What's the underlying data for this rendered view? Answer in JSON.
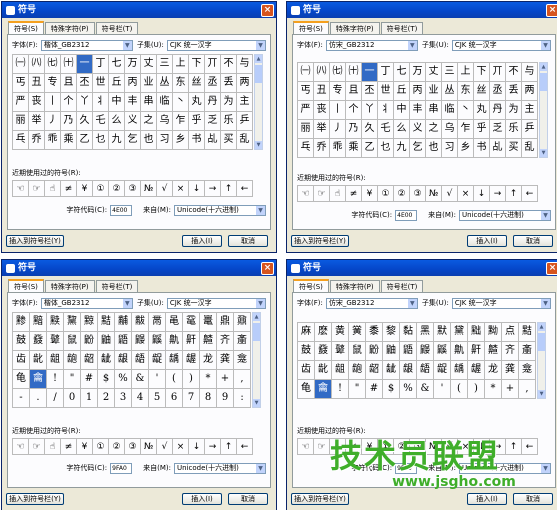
{
  "dialogs": [
    {
      "title": "符号",
      "tabs": [
        "符号(S)",
        "特殊字符(P)",
        "符号栏(T)"
      ],
      "font_label": "字体(F):",
      "font_value": "楷体_GB2312",
      "subset_label": "子集(U):",
      "subset_value": "CJK 统一汉字",
      "symbols": [
        [
          "㈠",
          "㈧",
          "㈦",
          "㈩",
          "一",
          "丁",
          "七",
          "万",
          "丈",
          "三",
          "上",
          "下",
          "丌",
          "不",
          "与"
        ],
        [
          "丐",
          "丑",
          "专",
          "且",
          "丕",
          "世",
          "丘",
          "丙",
          "业",
          "丛",
          "东",
          "丝",
          "丞",
          "丢",
          "两"
        ],
        [
          "严",
          "丧",
          "丨",
          "个",
          "丫",
          "丬",
          "中",
          "丰",
          "串",
          "临",
          "丶",
          "丸",
          "丹",
          "为",
          "主"
        ],
        [
          "丽",
          "举",
          "丿",
          "乃",
          "久",
          "乇",
          "么",
          "义",
          "之",
          "乌",
          "乍",
          "乎",
          "乏",
          "乐",
          "乒"
        ],
        [
          "乓",
          "乔",
          "乖",
          "乘",
          "乙",
          "乜",
          "九",
          "乞",
          "也",
          "习",
          "乡",
          "书",
          "乩",
          "买",
          "乱"
        ]
      ],
      "selected": [
        0,
        4
      ],
      "recent_label": "近期使用过的符号(R):",
      "recent": [
        "☜",
        "☞",
        "☝",
        "≠",
        "¥",
        "①",
        "②",
        "③",
        "№",
        "√",
        "×",
        "↓",
        "→",
        "↑",
        "←"
      ],
      "code_label": "字符代码(C):",
      "code_value": "4E00",
      "from_label": "来自(M):",
      "from_value": "Unicode(十六进制)",
      "insert_to_bar": "插入到符号栏(Y)",
      "insert": "插入(I)",
      "cancel": "取消"
    },
    {
      "title": "符号",
      "tabs": [
        "符号(S)",
        "特殊字符(P)",
        "符号栏(T)"
      ],
      "font_label": "字体(F):",
      "font_value": "仿宋_GB2312",
      "subset_label": "子集(U):",
      "subset_value": "CJK 统一汉字",
      "symbols": [
        [
          "㈠",
          "㈧",
          "㈦",
          "㈩",
          "一",
          "丁",
          "七",
          "万",
          "丈",
          "三",
          "上",
          "下",
          "丌",
          "不",
          "与"
        ],
        [
          "丐",
          "丑",
          "专",
          "且",
          "丕",
          "世",
          "丘",
          "丙",
          "业",
          "丛",
          "东",
          "丝",
          "丞",
          "丢",
          "两"
        ],
        [
          "严",
          "丧",
          "丨",
          "个",
          "丫",
          "丬",
          "中",
          "丰",
          "串",
          "临",
          "丶",
          "丸",
          "丹",
          "为",
          "主"
        ],
        [
          "丽",
          "举",
          "丿",
          "乃",
          "久",
          "乇",
          "么",
          "义",
          "之",
          "乌",
          "乍",
          "乎",
          "乏",
          "乐",
          "乒"
        ],
        [
          "乓",
          "乔",
          "乖",
          "乘",
          "乙",
          "乜",
          "九",
          "乞",
          "也",
          "习",
          "乡",
          "书",
          "乩",
          "买",
          "乱"
        ]
      ],
      "selected": [
        0,
        4
      ],
      "recent_label": "近期使用过的符号(R):",
      "recent": [
        "☜",
        "☞",
        "☝",
        "≠",
        "¥",
        "①",
        "②",
        "③",
        "№",
        "√",
        "×",
        "↓",
        "→",
        "↑",
        "←"
      ],
      "code_label": "字符代码(C):",
      "code_value": "4E00",
      "from_label": "来自(M):",
      "from_value": "Unicode(十六进制)",
      "insert_to_bar": "插入到符号栏(Y)",
      "insert": "插入(I)",
      "cancel": "取消"
    },
    {
      "title": "符号",
      "tabs": [
        "符号(S)",
        "特殊字符(P)",
        "符号栏(T)"
      ],
      "font_label": "字体(F):",
      "font_value": "楷体_GB2312",
      "subset_label": "子集(U):",
      "subset_value": "CJK 统一汉字",
      "symbols": [
        [
          "黪",
          "黯",
          "黩",
          "黧",
          "黥",
          "黠",
          "黼",
          "黻",
          "黹",
          "黾",
          "鼋",
          "鼍",
          "鼎",
          "鼐"
        ],
        [
          "鼓",
          "鼗",
          "鼙",
          "鼠",
          "鼢",
          "鼬",
          "鼯",
          "鼹",
          "鼷",
          "鼽",
          "鼾",
          "齄",
          "齐",
          "齑"
        ],
        [
          "齿",
          "龀",
          "龃",
          "龅",
          "龆",
          "龇",
          "龈",
          "龉",
          "龊",
          "龋",
          "龌",
          "龙",
          "龚",
          "龛"
        ],
        [
          "龟",
          "龠",
          "!",
          "\"",
          "#",
          "$",
          "%",
          "&",
          "'",
          "(",
          ")",
          "*",
          "+",
          ","
        ],
        [
          "-",
          ".",
          "/",
          "0",
          "1",
          "2",
          "3",
          "4",
          "5",
          "6",
          "7",
          "8",
          "9",
          ":"
        ]
      ],
      "selected": [
        3,
        1
      ],
      "recent_label": "近期使用过的符号(R):",
      "recent": [
        "☜",
        "☞",
        "☝",
        "≠",
        "¥",
        "①",
        "②",
        "③",
        "№",
        "√",
        "×",
        "↓",
        "→",
        "↑",
        "←"
      ],
      "code_label": "字符代码(C):",
      "code_value": "9FA0",
      "from_label": "来自(M):",
      "from_value": "Unicode(十六进制)",
      "insert_to_bar": "插入到符号栏(Y)",
      "insert": "插入(I)",
      "cancel": "取消"
    },
    {
      "title": "符号",
      "tabs": [
        "符号(S)",
        "特殊字符(P)",
        "符号栏(T)"
      ],
      "font_label": "字体(F):",
      "font_value": "仿宋_GB2312",
      "subset_label": "子集(U):",
      "subset_value": "CJK 统一汉字",
      "symbols": [
        [
          "麻",
          "麽",
          "黄",
          "黉",
          "黍",
          "黎",
          "黏",
          "黑",
          "默",
          "黛",
          "黜",
          "黝",
          "点",
          "黠"
        ],
        [
          "鼓",
          "鼗",
          "鼙",
          "鼠",
          "鼢",
          "鼬",
          "鼯",
          "鼹",
          "鼷",
          "鼽",
          "鼾",
          "齄",
          "齐",
          "齑"
        ],
        [
          "齿",
          "龀",
          "龃",
          "龅",
          "龆",
          "龇",
          "龈",
          "龉",
          "龊",
          "龋",
          "龌",
          "龙",
          "龚",
          "龛"
        ],
        [
          "龟",
          "龠",
          "!",
          "\"",
          "#",
          "$",
          "%",
          "&",
          "'",
          "(",
          ")",
          "*",
          "+",
          ","
        ]
      ],
      "selected": [
        3,
        1
      ],
      "recent_label": "近期使用过的符号(R):",
      "recent": [
        "☜",
        "☞",
        "☝",
        "≠",
        "¥",
        "①",
        "②",
        "③",
        "№",
        "√",
        "×",
        "↓",
        "→",
        "↑",
        "←"
      ],
      "code_label": "字符代码(C):",
      "code_value": "9FA0",
      "from_label": "来自(M):",
      "from_value": "Unicode(十六进制)",
      "insert_to_bar": "插入到符号栏(Y)",
      "insert": "插入(I)",
      "cancel": "取消"
    }
  ],
  "watermark": {
    "title": "技术员联盟",
    "url": "www.jsgho.com"
  },
  "colors": {
    "titlebar": "#0546c8",
    "selected_cell": "#316ac5",
    "watermark": "#3fae2a",
    "dialog_bg": "#ece9d8"
  }
}
